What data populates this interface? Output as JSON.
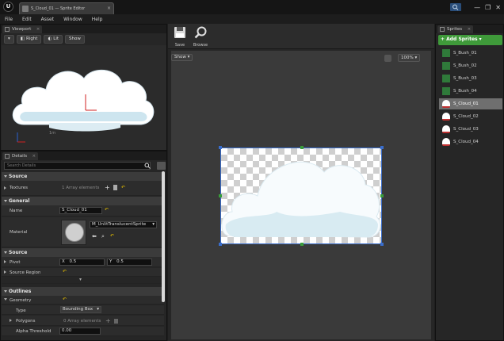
{
  "window": {
    "tab_title": "S_Cloud_01 — Sprite Editor",
    "controls": [
      "—",
      "❐",
      "✕"
    ]
  },
  "menu": [
    "File",
    "Edit",
    "Asset",
    "Window",
    "Help"
  ],
  "viewport": {
    "tab_label": "Viewport",
    "toolbar": {
      "view_mode": "Right",
      "lit": "Lit",
      "show": "Show"
    },
    "scale_label": "1m"
  },
  "details": {
    "tab_label": "Details",
    "search_placeholder": "Search Details",
    "categories": {
      "source_top": "Source",
      "general": "General",
      "source": "Source",
      "outlines": "Outlines"
    },
    "textures": {
      "label": "Textures",
      "value": "1 Array elements"
    },
    "name": {
      "label": "Name",
      "value": "S_Cloud_01"
    },
    "material": {
      "label": "Material",
      "value": "M_UnlitTranslucentSprite"
    },
    "pivot": {
      "label": "Pivot",
      "x_label": "X",
      "x_value": "0.5",
      "y_label": "Y",
      "y_value": "0.5"
    },
    "source_region": {
      "label": "Source Region"
    },
    "geometry": {
      "label": "Geometry"
    },
    "type": {
      "label": "Type",
      "value": "Bounding Box"
    },
    "polygons": {
      "label": "Polygons",
      "value": "0 Array elements"
    },
    "alpha_threshold": {
      "label": "Alpha Threshold",
      "value": "0.00"
    }
  },
  "editor": {
    "save_label": "Save",
    "browse_label": "Browse",
    "show_label": "Show",
    "zoom_label": "100%"
  },
  "sprites": {
    "tab_label": "Sprites",
    "add_label": "+ Add Sprites ▾",
    "items": [
      "S_Bush_01",
      "S_Bush_02",
      "S_Bush_03",
      "S_Bush_04",
      "S_Cloud_01",
      "S_Cloud_02",
      "S_Cloud_03",
      "S_Cloud_04"
    ],
    "selected": "S_Cloud_01"
  },
  "colors": {
    "accent_green": "#3f9a3a",
    "selection_blue": "#3a6ecc",
    "reset_yellow": "#e8c000",
    "cloud_light": "#e6f3f9"
  }
}
